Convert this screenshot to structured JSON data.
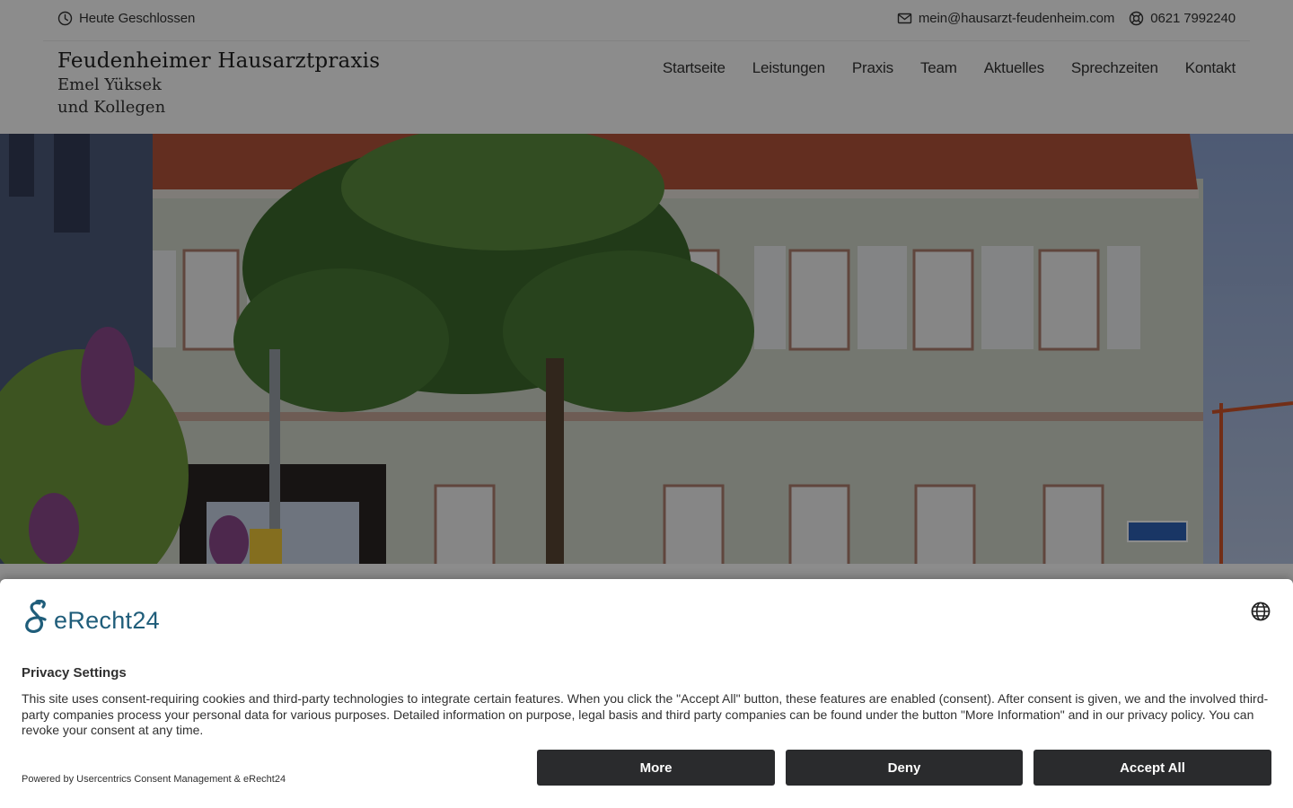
{
  "topbar": {
    "hours": "Heute Geschlossen",
    "email": "mein@hausarzt-feudenheim.com",
    "phone": "0621 7992240",
    "icons": {
      "hours": "clock-icon",
      "email": "mail-icon",
      "phone": "lifebuoy-icon"
    }
  },
  "brand": {
    "title": "Feudenheimer Hausarztpraxis",
    "line1": "Emel Yüksek",
    "line2": "und Kollegen"
  },
  "nav": {
    "items": [
      {
        "label": "Startseite"
      },
      {
        "label": "Leistungen"
      },
      {
        "label": "Praxis"
      },
      {
        "label": "Team"
      },
      {
        "label": "Aktuelles"
      },
      {
        "label": "Sprechzeiten"
      },
      {
        "label": "Kontakt"
      }
    ]
  },
  "hero": {
    "alt_description": "photo-of-practice-building"
  },
  "consent": {
    "logo_text": "eRecht24",
    "title": "Privacy Settings",
    "body": "This site uses consent-requiring cookies and third-party technologies to integrate certain features. When you click the \"Accept All\" button, these features are enabled (consent). After consent is given, we and the involved third-party companies process your personal data for various purposes. Detailed information on purpose, legal basis and third party companies can be found under the button \"More Information\" and in our privacy policy. You can revoke your consent at any time.",
    "powered": "Powered by Usercentrics Consent Management & eRecht24",
    "buttons": {
      "more": "More",
      "deny": "Deny",
      "accept": "Accept All"
    },
    "colors": {
      "logo": "#1f5d7a",
      "button": "#2a2b2d"
    }
  }
}
